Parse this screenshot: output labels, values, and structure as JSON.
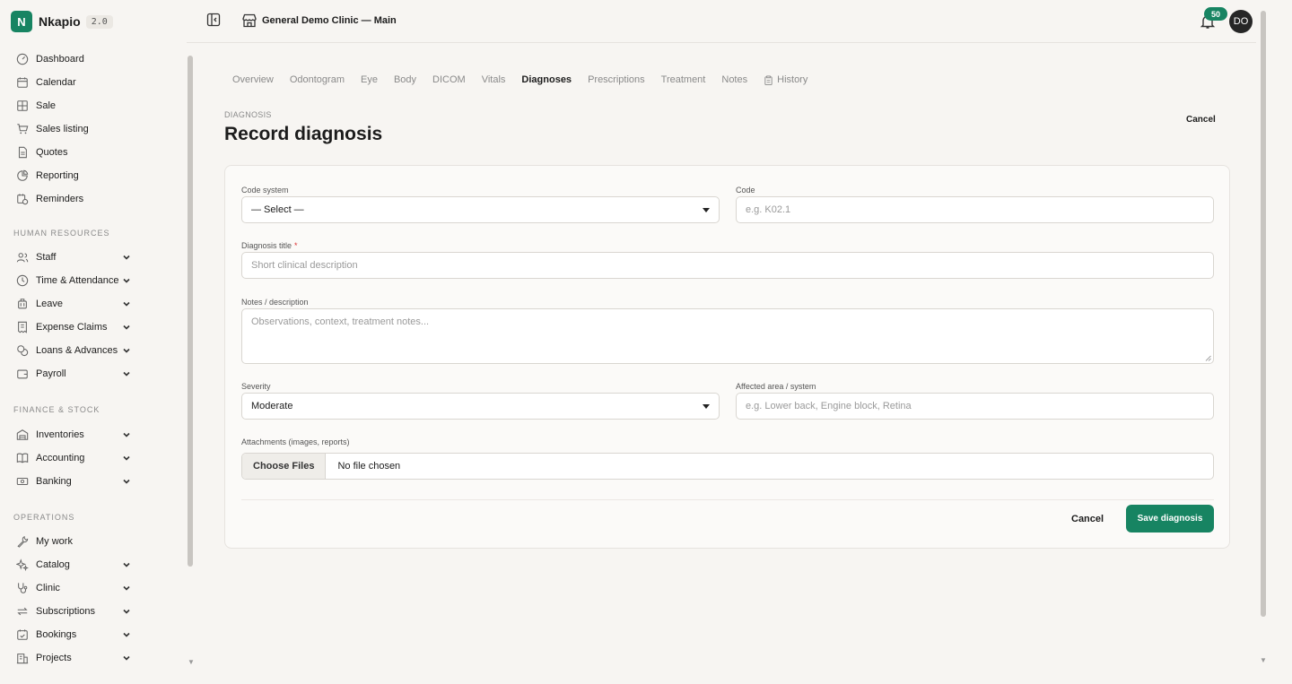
{
  "brand": {
    "logo_letter": "N",
    "name": "Nkapio",
    "version": "2.0"
  },
  "sidebar": {
    "main_items": [
      {
        "label": "Dashboard",
        "icon": "gauge-icon"
      },
      {
        "label": "Calendar",
        "icon": "calendar-icon"
      },
      {
        "label": "Sale",
        "icon": "grid-icon"
      },
      {
        "label": "Sales listing",
        "icon": "cart-icon"
      },
      {
        "label": "Quotes",
        "icon": "document-icon"
      },
      {
        "label": "Reporting",
        "icon": "pie-chart-icon"
      },
      {
        "label": "Reminders",
        "icon": "calendar-clock-icon"
      }
    ],
    "sections": [
      {
        "title": "HUMAN RESOURCES",
        "items": [
          {
            "label": "Staff",
            "icon": "users-icon"
          },
          {
            "label": "Time & Attendance",
            "icon": "clock-icon"
          },
          {
            "label": "Leave",
            "icon": "luggage-icon"
          },
          {
            "label": "Expense Claims",
            "icon": "receipt-icon"
          },
          {
            "label": "Loans & Advances",
            "icon": "coins-icon"
          },
          {
            "label": "Payroll",
            "icon": "wallet-icon"
          }
        ]
      },
      {
        "title": "FINANCE & STOCK",
        "items": [
          {
            "label": "Inventories",
            "icon": "warehouse-icon"
          },
          {
            "label": "Accounting",
            "icon": "book-icon"
          },
          {
            "label": "Banking",
            "icon": "banknote-icon"
          }
        ]
      },
      {
        "title": "OPERATIONS",
        "items": [
          {
            "label": "My work",
            "icon": "wrench-icon",
            "expandable": false
          },
          {
            "label": "Catalog",
            "icon": "sparkles-icon"
          },
          {
            "label": "Clinic",
            "icon": "stethoscope-icon"
          },
          {
            "label": "Subscriptions",
            "icon": "repeat-icon"
          },
          {
            "label": "Bookings",
            "icon": "calendar-check-icon"
          },
          {
            "label": "Projects",
            "icon": "building-icon"
          }
        ]
      }
    ]
  },
  "topbar": {
    "clinic_name": "General Demo Clinic — Main",
    "notification_count": "50",
    "avatar_initials": "DO"
  },
  "tabs": [
    {
      "label": "Overview",
      "active": false
    },
    {
      "label": "Odontogram",
      "active": false
    },
    {
      "label": "Eye",
      "active": false
    },
    {
      "label": "Body",
      "active": false
    },
    {
      "label": "DICOM",
      "active": false
    },
    {
      "label": "Vitals",
      "active": false
    },
    {
      "label": "Diagnoses",
      "active": true
    },
    {
      "label": "Prescriptions",
      "active": false
    },
    {
      "label": "Treatment",
      "active": false
    },
    {
      "label": "Notes",
      "active": false
    },
    {
      "label": "History",
      "active": false,
      "icon": "clipboard-icon"
    }
  ],
  "header": {
    "eyebrow": "DIAGNOSIS",
    "title": "Record diagnosis",
    "cancel_label": "Cancel"
  },
  "form": {
    "code_system": {
      "label": "Code system",
      "value": "— Select —"
    },
    "code": {
      "label": "Code",
      "placeholder": "e.g. K02.1"
    },
    "diagnosis_title": {
      "label": "Diagnosis title",
      "required_mark": "*",
      "placeholder": "Short clinical description"
    },
    "notes": {
      "label": "Notes / description",
      "placeholder": "Observations, context, treatment notes..."
    },
    "severity": {
      "label": "Severity",
      "value": "Moderate"
    },
    "affected_area": {
      "label": "Affected area / system",
      "placeholder": "e.g. Lower back, Engine block, Retina"
    },
    "attachments": {
      "label": "Attachments (images, reports)",
      "button_label": "Choose Files",
      "status": "No file chosen"
    },
    "cancel_label": "Cancel",
    "save_label": "Save diagnosis"
  },
  "colors": {
    "accent": "#178462",
    "background": "#f7f5f2",
    "card": "#fbfaf8"
  }
}
